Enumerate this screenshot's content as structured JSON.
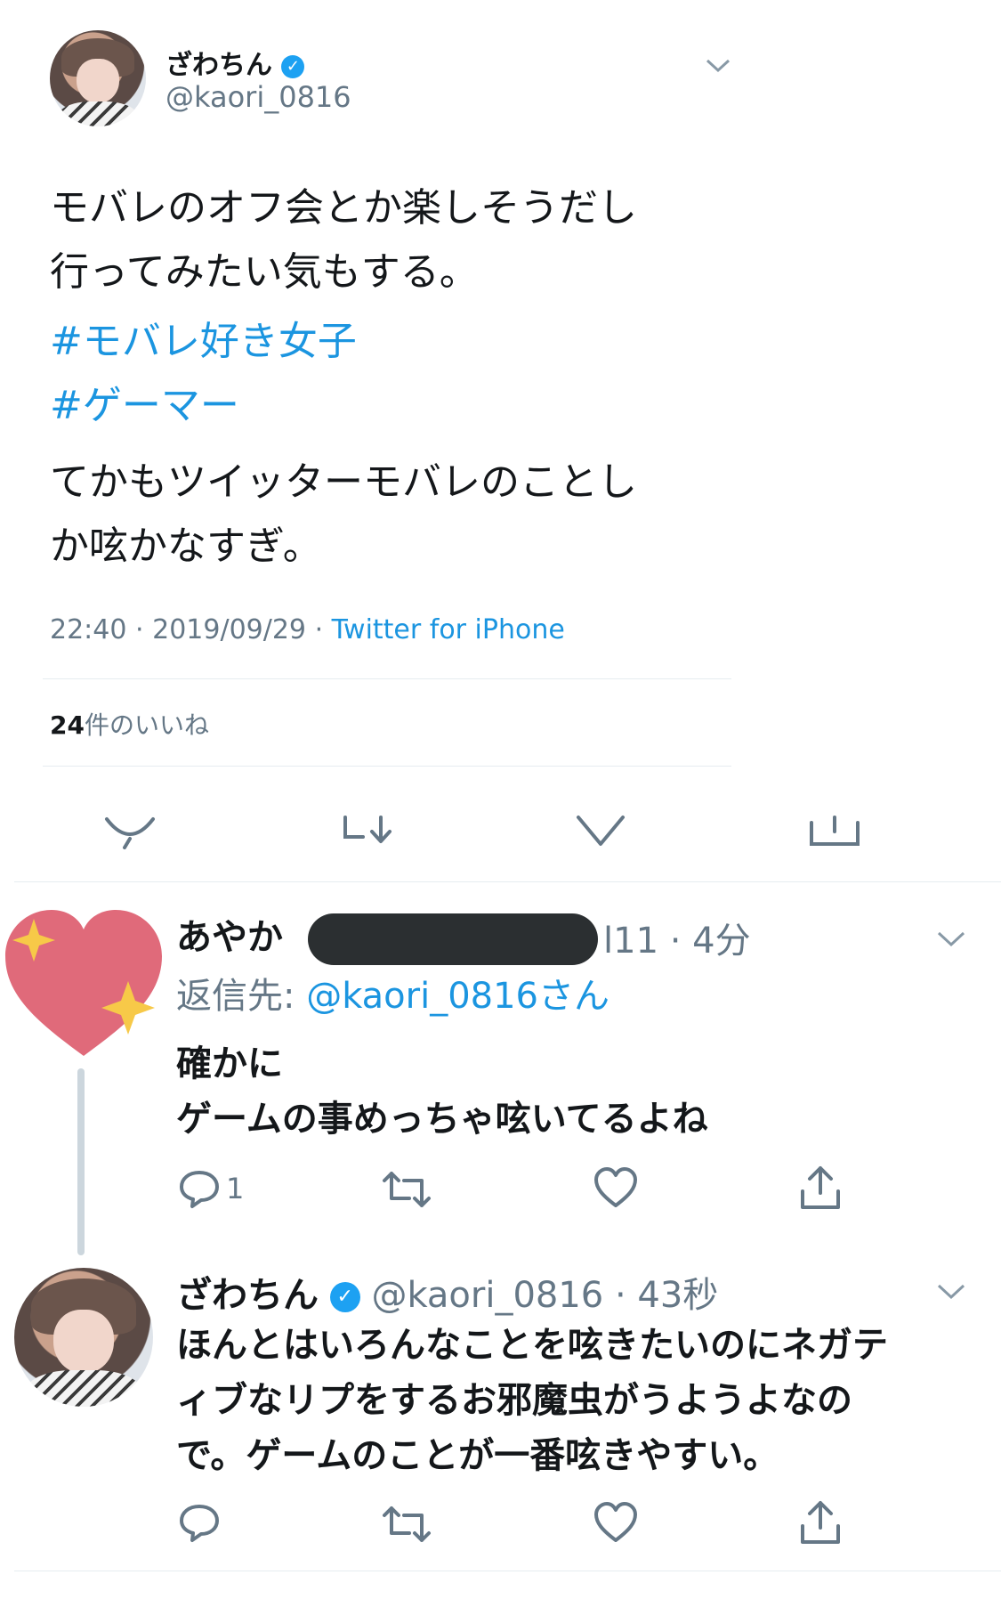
{
  "main_tweet": {
    "display_name": "ざわちん",
    "handle": "@kaori_0816",
    "body_lines": [
      "モバレのオフ会とか楽しそうだし",
      "行ってみたい気もする。"
    ],
    "hashtags": [
      "#モバレ好き女子",
      "#ゲーマー"
    ],
    "body_lines_2": [
      "てかもツイッターモバレのことし",
      "か呟かなすぎ。"
    ],
    "time": "22:40",
    "sep1": "·",
    "date": "2019/09/29",
    "sep2": "·",
    "source": "Twitter for iPhone",
    "likes_count": "24",
    "likes_label": "件のいいね"
  },
  "reply_1": {
    "display_name": "あやか",
    "handle_tail": "l11",
    "sep": "·",
    "time": "4分",
    "reply_to_label": "返信先: ",
    "reply_to_handle": "@kaori_0816さん",
    "body_lines": [
      "確かに",
      "ゲームの事めっちゃ呟いてるよね"
    ],
    "reply_count": "1"
  },
  "reply_2": {
    "display_name": "ざわちん",
    "handle": "@kaori_0816",
    "sep": "·",
    "time": "43秒",
    "body_lines": [
      "ほんとはいろんなことを呟きたいのにネガテ",
      "ィブなリプをするお邪魔虫がうようよなの",
      "で。ゲームのことが一番呟きやすい。"
    ]
  },
  "icons": {
    "main_actions": [
      "reply-icon",
      "retweet-icon",
      "like-icon",
      "share-icon"
    ],
    "reply_actions": [
      "reply-icon",
      "retweet-icon",
      "like-icon",
      "share-icon"
    ],
    "menu": "chevron-down-icon",
    "verified": "verified-badge-icon",
    "heart_avatar": "sparkle-heart-icon"
  },
  "colors": {
    "link_blue": "#1b95e0",
    "verified_blue": "#1da1f2",
    "muted": "#657786",
    "heart_pink": "#e06a7a",
    "sparkle_yellow": "#f7c948",
    "redaction": "#2b2f31"
  }
}
